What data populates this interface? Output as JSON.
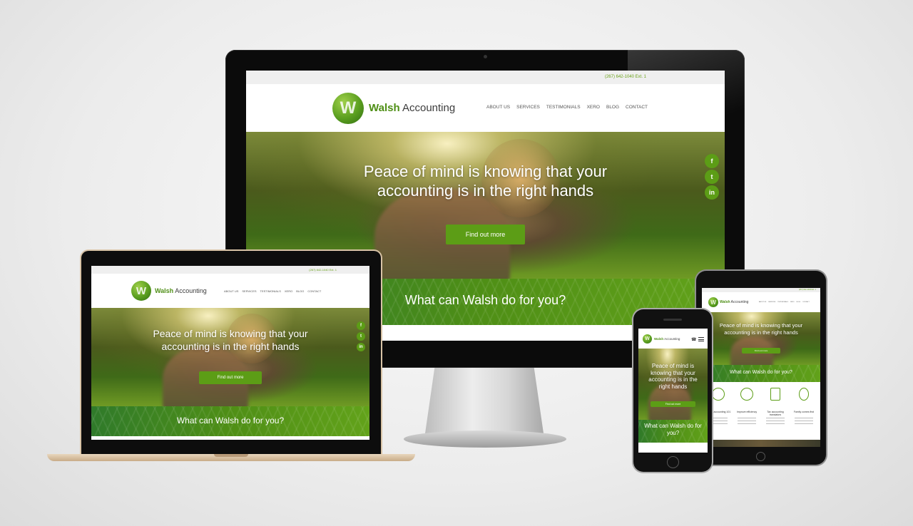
{
  "site": {
    "phone": "(267) 642-1040 Ext. 1",
    "logo_brand": "Walsh",
    "logo_rest": "Accounting",
    "logo_letter": "W",
    "nav": [
      "ABOUT US",
      "SERVICES",
      "TESTIMONIALS",
      "XERO",
      "BLOG",
      "CONTACT"
    ],
    "hero_title": "Peace of mind is knowing that your accounting is in the right hands",
    "cta": "Find out more",
    "band_title": "What can Walsh do for you?",
    "social": [
      "f",
      "t",
      "in"
    ],
    "services": [
      {
        "title": "Virtual accounting 101",
        "icon": "network-icon"
      },
      {
        "title": "Improve efficiency",
        "icon": "speedometer-icon"
      },
      {
        "title": "Tax accounting translators",
        "icon": "document-icon"
      },
      {
        "title": "Family comes first",
        "icon": "family-icon"
      }
    ]
  },
  "colors": {
    "brand_green": "#5c9d16",
    "phone_text": "#6aa21a",
    "background": "#ececec"
  }
}
